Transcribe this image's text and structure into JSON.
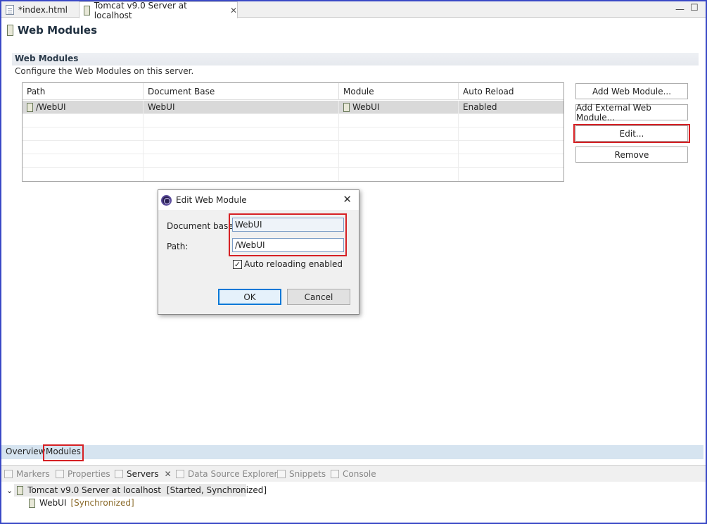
{
  "editor_tabs": [
    {
      "label": "*index.html",
      "icon": "html-file-icon"
    },
    {
      "label": "Tomcat v9.0 Server at localhost",
      "icon": "server-icon"
    }
  ],
  "editor": {
    "title": "Web Modules",
    "section_title": "Web Modules",
    "section_desc": "Configure the Web Modules on this server."
  },
  "table": {
    "headers": [
      "Path",
      "Document Base",
      "Module",
      "Auto Reload"
    ],
    "rows": [
      {
        "path": "/WebUI",
        "doc_base": "WebUI",
        "module": "WebUI",
        "auto_reload": "Enabled"
      }
    ]
  },
  "side_buttons": {
    "add": "Add Web Module...",
    "add_external": "Add External Web Module...",
    "edit": "Edit...",
    "remove": "Remove"
  },
  "dialog": {
    "title": "Edit Web Module",
    "doc_base_label": "Document base:",
    "doc_base_value": "WebUI",
    "path_label": "Path:",
    "path_value": "/WebUI",
    "auto_reload_label": "Auto reloading enabled",
    "auto_reload_checked": true,
    "ok": "OK",
    "cancel": "Cancel"
  },
  "bottom_tabs": {
    "overview": "Overview",
    "modules": "Modules"
  },
  "views": {
    "markers": "Markers",
    "properties": "Properties",
    "servers": "Servers",
    "data_source": "Data Source Explorer",
    "snippets": "Snippets",
    "console": "Console"
  },
  "servers_tree": {
    "server": "Tomcat v9.0 Server at localhost",
    "server_status": "[Started, Synchronized]",
    "module": "WebUI",
    "module_status": "[Synchronized]"
  },
  "colors": {
    "highlight": "#d62024",
    "window_border": "#3a49c6"
  }
}
